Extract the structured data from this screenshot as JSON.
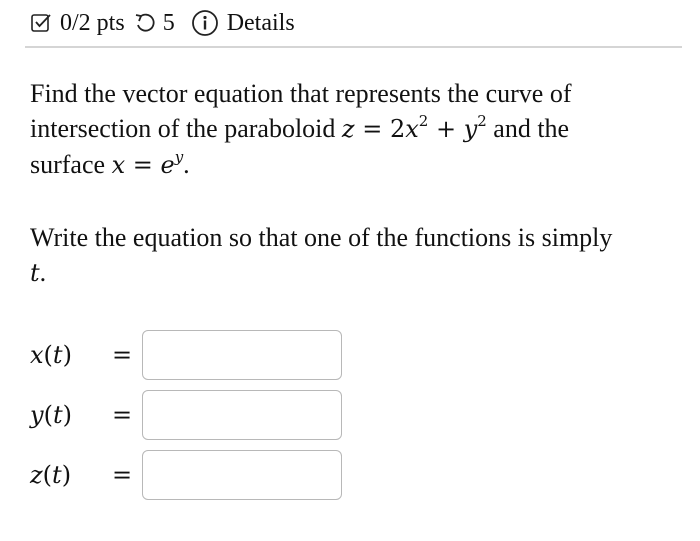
{
  "header": {
    "score": "0/2 pts",
    "attempts": "5",
    "details_label": "Details",
    "icons": [
      "checkbox-icon",
      "retry-icon",
      "info-icon"
    ]
  },
  "question": {
    "line1": "Find the vector equation that represents the curve of",
    "line2_prefix": "intersection of the paraboloid",
    "line2_suffix": "and the",
    "line3_prefix": "surface",
    "instruction": "Write the equation so that one of the functions is simply",
    "instruction_var": "t",
    "instruction_end": "."
  },
  "answers": [
    {
      "fn": "x",
      "arg": "t",
      "value": ""
    },
    {
      "fn": "y",
      "arg": "t",
      "value": ""
    },
    {
      "fn": "z",
      "arg": "t",
      "value": ""
    }
  ]
}
